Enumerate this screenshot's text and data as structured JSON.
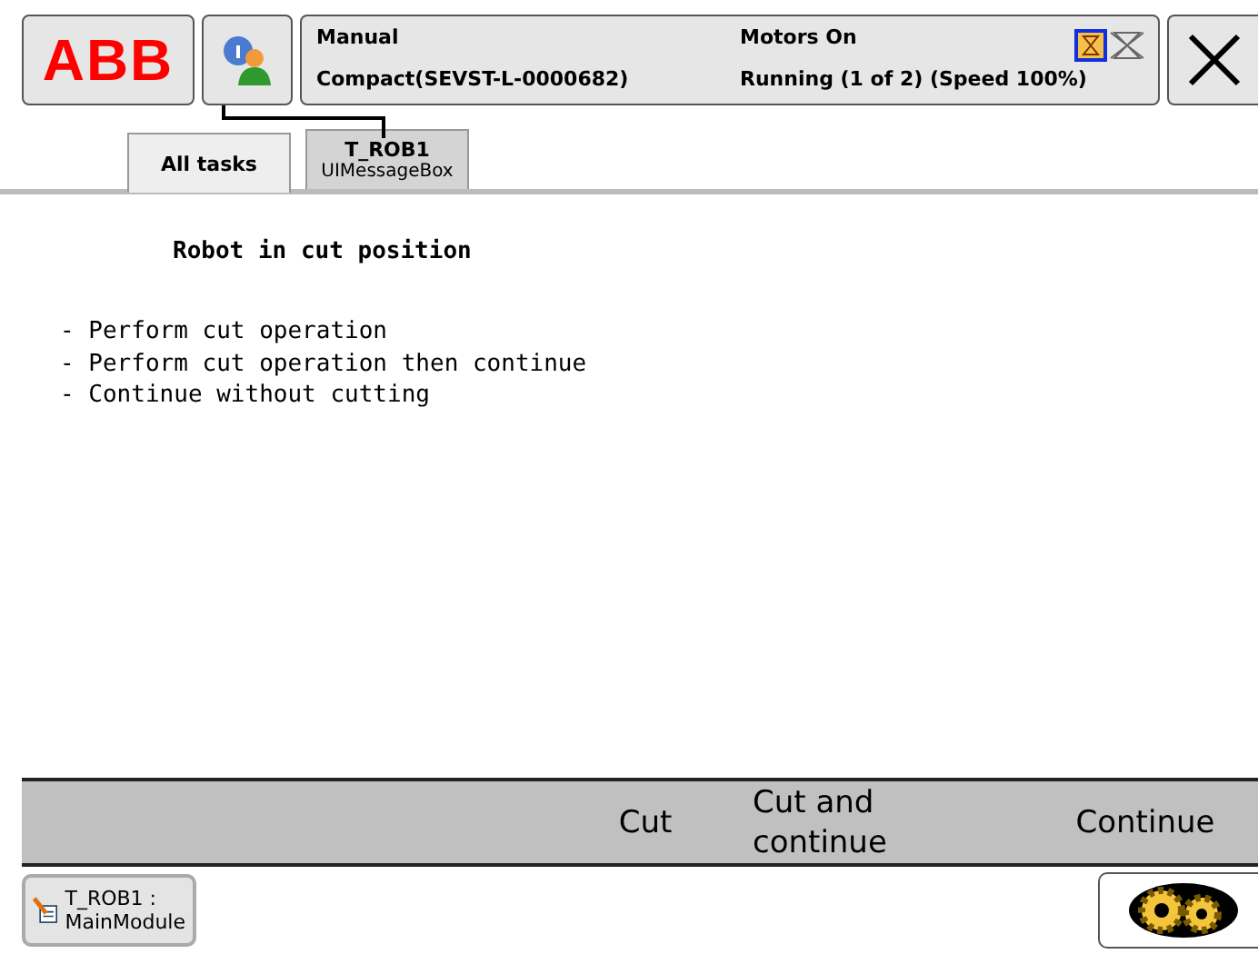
{
  "header": {
    "logo": "ABB",
    "mode": "Manual",
    "controller": "Compact(SEVST-L-0000682)",
    "motors": "Motors On",
    "run_state": "Running (1 of 2) (Speed 100%)"
  },
  "tabs": [
    {
      "title": "All tasks",
      "selected": false
    },
    {
      "title": "T_ROB1",
      "subtitle": "UIMessageBox",
      "selected": true
    }
  ],
  "message": {
    "title": "Robot in cut position",
    "lines": [
      "- Perform cut operation",
      "- Perform cut operation then continue",
      "- Continue without cutting"
    ]
  },
  "buttons": [
    "Cut",
    "Cut and\ncontinue",
    "Continue"
  ],
  "taskbar": {
    "item": "T_ROB1 :\nMainModule"
  }
}
